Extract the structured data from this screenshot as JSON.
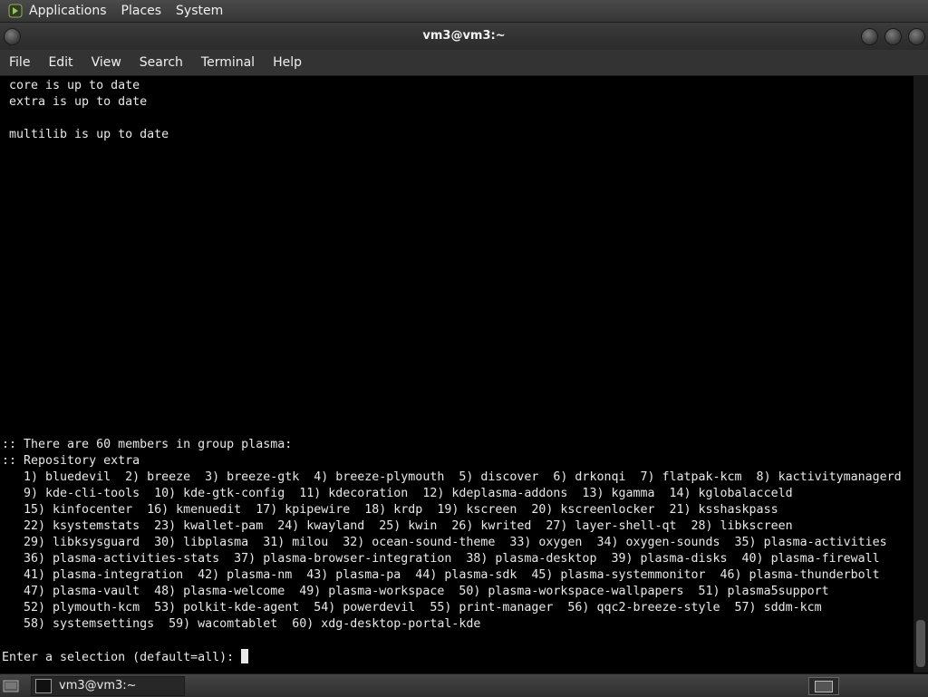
{
  "top_panel": {
    "menus": [
      "Applications",
      "Places",
      "System"
    ]
  },
  "window": {
    "title": "vm3@vm3:~"
  },
  "menubar": {
    "items": [
      "File",
      "Edit",
      "View",
      "Search",
      "Terminal",
      "Help"
    ]
  },
  "terminal": {
    "lines": [
      "core is up to date",
      "extra is up to date",
      "",
      "multilib is up to date",
      "",
      "",
      "",
      "",
      "",
      "",
      "",
      "",
      "",
      "",
      "",
      "",
      "",
      "",
      "",
      "",
      "",
      "",
      ":: There are 60 members in group plasma:",
      ":: Repository extra",
      "   1) bluedevil  2) breeze  3) breeze-gtk  4) breeze-plymouth  5) discover  6) drkonqi  7) flatpak-kcm  8) kactivitymanagerd",
      "   9) kde-cli-tools  10) kde-gtk-config  11) kdecoration  12) kdeplasma-addons  13) kgamma  14) kglobalacceld",
      "   15) kinfocenter  16) kmenuedit  17) kpipewire  18) krdp  19) kscreen  20) kscreenlocker  21) ksshaskpass",
      "   22) ksystemstats  23) kwallet-pam  24) kwayland  25) kwin  26) kwrited  27) layer-shell-qt  28) libkscreen",
      "   29) libksysguard  30) libplasma  31) milou  32) ocean-sound-theme  33) oxygen  34) oxygen-sounds  35) plasma-activities",
      "   36) plasma-activities-stats  37) plasma-browser-integration  38) plasma-desktop  39) plasma-disks  40) plasma-firewall",
      "   41) plasma-integration  42) plasma-nm  43) plasma-pa  44) plasma-sdk  45) plasma-systemmonitor  46) plasma-thunderbolt",
      "   47) plasma-vault  48) plasma-welcome  49) plasma-workspace  50) plasma-workspace-wallpapers  51) plasma5support",
      "   52) plymouth-kcm  53) polkit-kde-agent  54) powerdevil  55) print-manager  56) qqc2-breeze-style  57) sddm-kcm",
      "   58) systemsettings  59) wacomtablet  60) xdg-desktop-portal-kde",
      ""
    ],
    "prompt": "Enter a selection (default=all): "
  },
  "taskbar": {
    "task_label": "vm3@vm3:~"
  },
  "icons": {
    "logo": "gnome-foot-icon",
    "show_desktop": "show-desktop-icon",
    "terminal": "terminal-icon",
    "workspace": "workspace-switcher-icon"
  }
}
